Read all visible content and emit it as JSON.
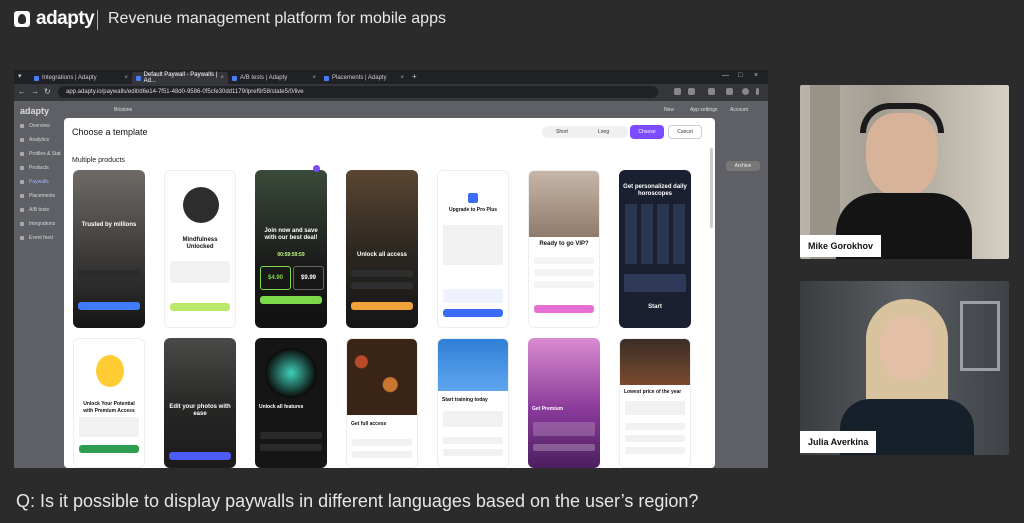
{
  "brand": {
    "logo": "adapty",
    "tagline": "Revenue management platform for mobile apps"
  },
  "question": "Q: Is it possible to display paywalls in different languages based on the user’s region?",
  "browser": {
    "tabs": [
      {
        "label": "Integrations | Adapty"
      },
      {
        "label": "Default Paywall - Paywalls | Ad..."
      },
      {
        "label": "A/B tests | Adapty"
      },
      {
        "label": "Placements | Adapty"
      }
    ],
    "url": "app.adapty.io/paywalls/edit/d6e14-7f51-48d0-9586-0f5cfe30dd1179/ipref9/58/state5/0/live"
  },
  "app": {
    "logo": "adapty",
    "header": {
      "project": "Bristone",
      "new": "New",
      "app_settings": "App settings",
      "account": "Account"
    },
    "sidebar": [
      "Overview",
      "Analytics",
      "Profiles & Stat",
      "Products",
      "Paywalls",
      "Placements",
      "A/B tests",
      "Integrations",
      "Event feed"
    ],
    "right_button": "Archive"
  },
  "modal": {
    "title": "Choose a template",
    "seg_short": "Short",
    "seg_long": "Long",
    "choose": "Choose",
    "cancel": "Cancel",
    "section": "Multiple products",
    "cards_row1": [
      {
        "title": "Trusted by millions"
      },
      {
        "title": "Mindfulness Unlocked"
      },
      {
        "title": "Join now and save with our best deal!",
        "timer": "00:59:59:59",
        "price_a": "$4.90",
        "price_b": "$9.99"
      },
      {
        "title": "Unlock all access"
      },
      {
        "title": "Upgrade to Pro Plus"
      },
      {
        "title": "Ready to go VIP?"
      },
      {
        "title": "Get personalized daily horoscopes",
        "cta": "Start"
      }
    ],
    "cards_row2": [
      {
        "title": "Unlock Your Potential with Premium Access"
      },
      {
        "title": "Edit your photos with ease"
      },
      {
        "title": "Unlock all features"
      },
      {
        "title": "Get full access"
      },
      {
        "title": "Start training today"
      },
      {
        "title": "Get Premium"
      },
      {
        "title": "Lowest price of the year"
      }
    ]
  },
  "participants": [
    {
      "name": "Mike Gorokhov"
    },
    {
      "name": "Julia Averkina"
    }
  ],
  "colors": {
    "accent": "#7b4cff",
    "background": "#2b2b2b"
  }
}
